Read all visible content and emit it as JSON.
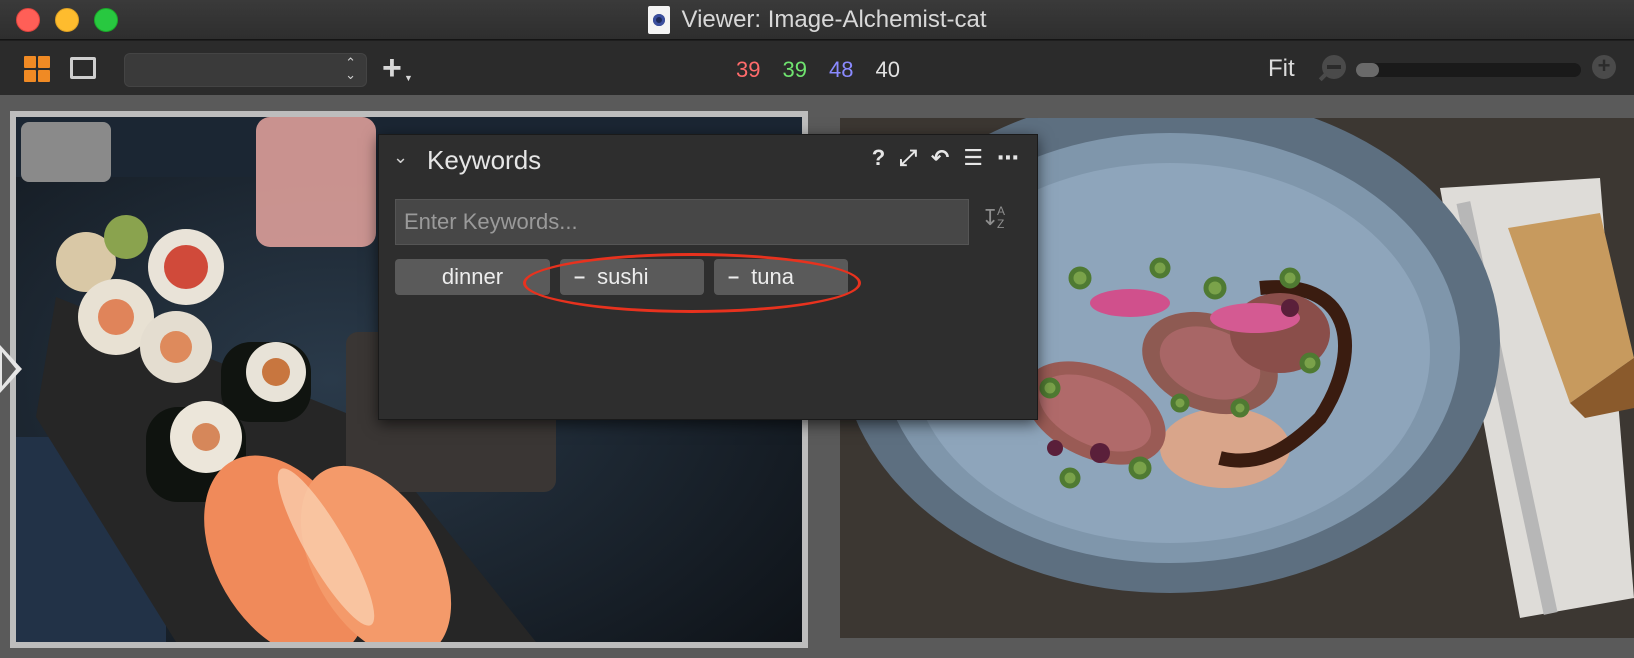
{
  "window": {
    "title": "Viewer: Image-Alchemist-cat"
  },
  "toolbar": {
    "counts": {
      "red": "39",
      "green": "39",
      "blue": "48",
      "white": "40"
    },
    "zoom_label": "Fit",
    "zoom_level": 0.1
  },
  "keywords_panel": {
    "title": "Keywords",
    "input_placeholder": "Enter Keywords...",
    "sort_label": "A Z",
    "tags": [
      {
        "label": "dinner"
      },
      {
        "label": "sushi"
      },
      {
        "label": "tuna"
      }
    ],
    "tools": [
      "help-icon",
      "expand-icon",
      "reset-icon",
      "list-icon",
      "more-icon"
    ]
  },
  "colors": {
    "accent": "#f08a24",
    "annotation": "#e8321e"
  }
}
